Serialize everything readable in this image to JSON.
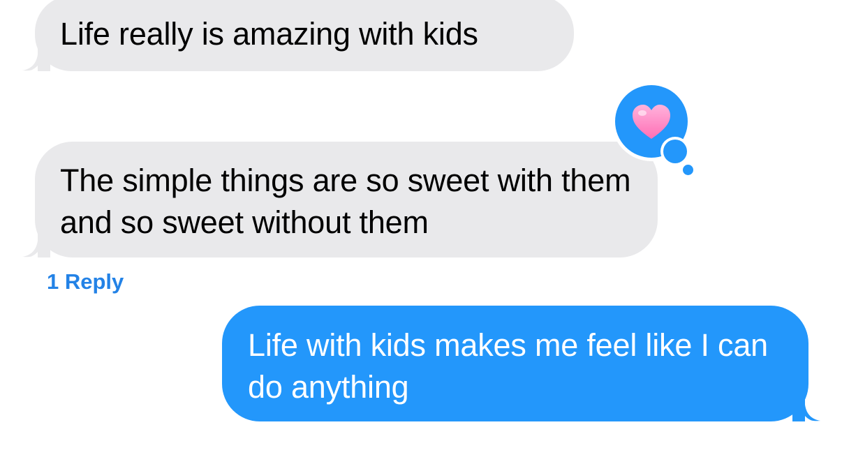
{
  "conversation": {
    "messages": [
      {
        "direction": "incoming",
        "text": "Life really is amazing with kids"
      },
      {
        "direction": "incoming",
        "text": "The simple things are so sweet with them and so sweet without them"
      },
      {
        "direction": "outgoing",
        "text": "Life with kids makes me feel like I can do anything"
      }
    ],
    "tapback": {
      "icon": "heart-icon",
      "color": "#2397fb",
      "heart_color": "#ff8ec8"
    },
    "reply_count_label": "1 Reply"
  },
  "colors": {
    "incoming_bubble": "#e9e9eb",
    "outgoing_bubble": "#2397fb",
    "link": "#2382e6",
    "background": "#ffffff"
  }
}
